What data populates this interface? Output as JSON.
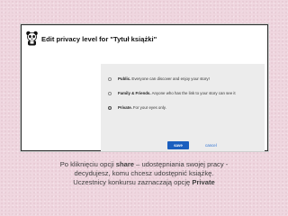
{
  "dialog": {
    "title": "Edit privacy level for \"Tytuł książki\""
  },
  "options": [
    {
      "label": "Public.",
      "description": "Everyone can discover and enjoy your story!",
      "selected": false
    },
    {
      "label": "Family & Friends.",
      "description": "Anyone who has the link to your story can see it",
      "selected": false
    },
    {
      "label": "Private.",
      "description": "For your eyes only.",
      "selected": true
    }
  ],
  "actions": {
    "save_label": "save",
    "cancel_label": "cancel"
  },
  "caption": {
    "line1_before": "Po kliknięciu opcji ",
    "line1_bold": "share",
    "line1_after": " – udostępniania swojej pracy -",
    "line2": "decydujesz, komu chcesz udostępnić książkę.",
    "line3_before": "Uczestnicy konkursu zaznaczają opcję ",
    "line3_bold": "Private"
  },
  "colors": {
    "background": "#efd6df",
    "save_button": "#1b5fbf",
    "cancel_link": "#2a6fd1",
    "options_panel": "#ececec"
  },
  "icons": {
    "logo": "panda-logo-icon"
  }
}
